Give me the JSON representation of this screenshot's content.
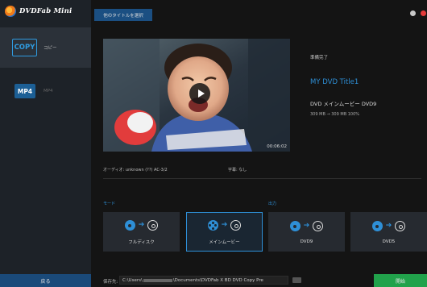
{
  "app": {
    "logo_text": "DVDFab Mini"
  },
  "sidebar": {
    "items": [
      {
        "badge": "COPY",
        "label": "コピー",
        "active": true
      },
      {
        "badge": "MP4",
        "label": "MP4",
        "active": false
      }
    ],
    "back_label": "戻る"
  },
  "header": {
    "title_select_label": "他のタイトルを選択"
  },
  "preview": {
    "timecode": "00:06:02"
  },
  "disc_info": {
    "status": "準備完了",
    "title": "MY DVD Title1",
    "type": "DVD メインムービー DVD9",
    "size": "309 MB → 309 MB  100%"
  },
  "tracks": {
    "audio": "オーディオ: unknown (??) AC-3/2",
    "subtitle": "字幕: なし"
  },
  "mode": {
    "section_label": "モード",
    "options": [
      {
        "label": "フルディスク",
        "selected": false
      },
      {
        "label": "メインムービー",
        "selected": true
      }
    ]
  },
  "output": {
    "section_label": "出力",
    "options": [
      {
        "label": "DVD9",
        "selected": false
      },
      {
        "label": "DVD5",
        "selected": false
      }
    ]
  },
  "footer": {
    "save_label": "保存先:",
    "path_prefix": "C:\\Users\\",
    "path_suffix": "\\Documents\\DVDFab X BD DVD Copy Pre",
    "start_label": "開始"
  },
  "colors": {
    "accent": "#2e8fd6",
    "start": "#21a24b",
    "close": "#e53a3a"
  }
}
